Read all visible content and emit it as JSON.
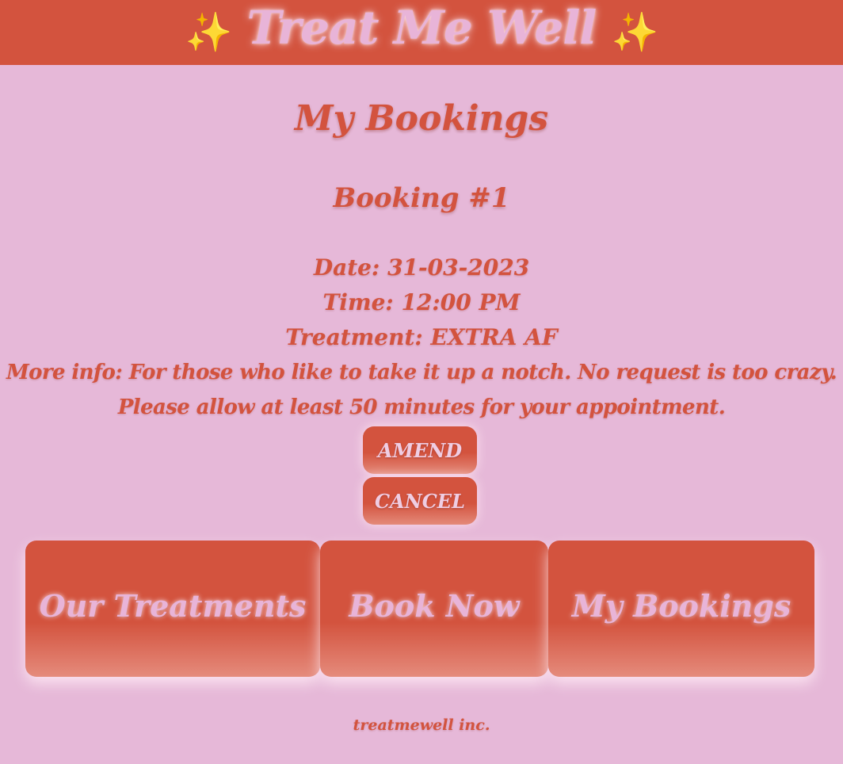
{
  "header": {
    "sparkle_left": "✨",
    "title": "Treat Me Well",
    "sparkle_right": "✨"
  },
  "main": {
    "page_title": "My Bookings",
    "booking": {
      "title": "Booking #1",
      "date_line": "Date: 31-03-2023",
      "time_line": "Time: 12:00 PM",
      "treatment_line": "Treatment: EXTRA AF",
      "more_info_line": "More info: For those who like to take it up a notch. No request is too crazy.",
      "duration_line": "Please allow at least 50 minutes for your appointment.",
      "amend_label": "AMEND",
      "cancel_label": "CANCEL"
    }
  },
  "nav": {
    "items": [
      {
        "label": "Our Treatments"
      },
      {
        "label": "Book Now"
      },
      {
        "label": "My Bookings"
      }
    ]
  },
  "footer": {
    "text": "treatmewell inc."
  },
  "colors": {
    "background": "#e6b8d8",
    "accent": "#d3533e",
    "sparkle": "#f6c945",
    "pink_text": "#e8b4d8"
  }
}
